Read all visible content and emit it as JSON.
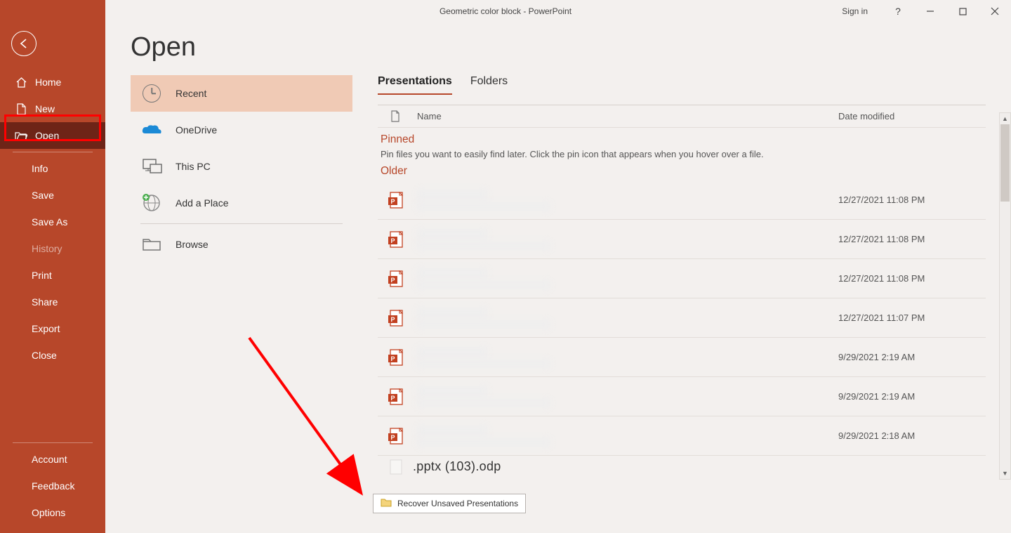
{
  "titlebar": {
    "title": "Geometric color block  -  PowerPoint",
    "signin": "Sign in"
  },
  "sidebar": {
    "home": "Home",
    "new": "New",
    "open": "Open",
    "info": "Info",
    "save": "Save",
    "saveas": "Save As",
    "history": "History",
    "print": "Print",
    "share": "Share",
    "export": "Export",
    "close": "Close",
    "account": "Account",
    "feedback": "Feedback",
    "options": "Options"
  },
  "main": {
    "heading": "Open",
    "sources": {
      "recent": "Recent",
      "onedrive": "OneDrive",
      "thispc": "This PC",
      "addplace": "Add a Place",
      "browse": "Browse"
    },
    "tabs": {
      "presentations": "Presentations",
      "folders": "Folders"
    },
    "cols": {
      "name": "Name",
      "modified": "Date modified"
    },
    "sections": {
      "pinned": "Pinned",
      "pinhint": "Pin files you want to easily find later. Click the pin icon that appears when you hover over a file.",
      "older": "Older"
    },
    "files": [
      {
        "modified": "12/27/2021 11:08 PM"
      },
      {
        "modified": "12/27/2021 11:08 PM"
      },
      {
        "modified": "12/27/2021 11:08 PM"
      },
      {
        "modified": "12/27/2021 11:07 PM"
      },
      {
        "modified": "9/29/2021 2:19 AM"
      },
      {
        "modified": "9/29/2021 2:19 AM"
      },
      {
        "modified": "9/29/2021 2:18 AM"
      }
    ],
    "partial": ".pptx (103).odp",
    "recover": "Recover Unsaved Presentations"
  }
}
